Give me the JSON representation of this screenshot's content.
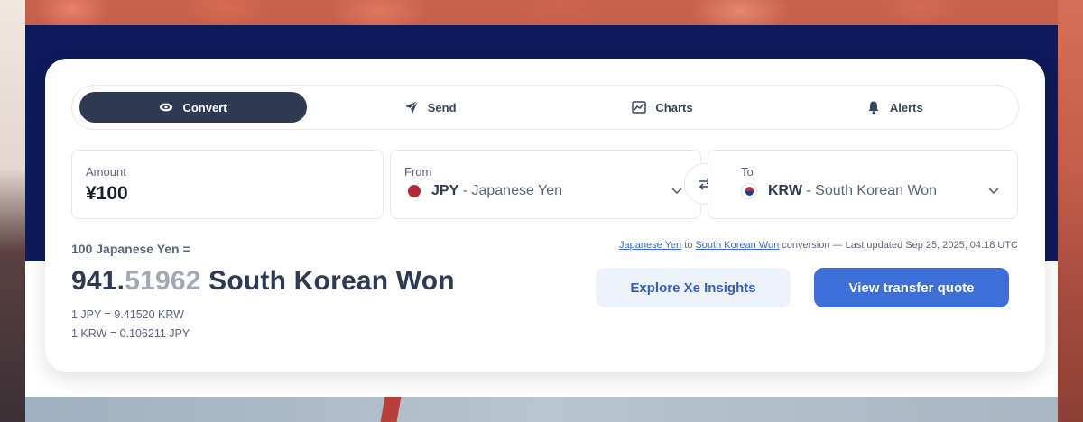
{
  "tabs": [
    {
      "label": "Convert",
      "icon": "money-icon",
      "active": true
    },
    {
      "label": "Send",
      "icon": "send-icon",
      "active": false
    },
    {
      "label": "Charts",
      "icon": "chart-icon",
      "active": false
    },
    {
      "label": "Alerts",
      "icon": "bell-icon",
      "active": false
    }
  ],
  "amount": {
    "label": "Amount",
    "value": "¥100"
  },
  "from": {
    "label": "From",
    "code": "JPY",
    "name": "- Japanese Yen"
  },
  "to": {
    "label": "To",
    "code": "KRW",
    "name": "- South Korean Won"
  },
  "result": {
    "line1": "100 Japanese Yen =",
    "int_part": "941.",
    "dec_part": "51962",
    "currency": " South Korean Won",
    "rate1": "1 JPY = 9.41520 KRW",
    "rate2": "1 KRW = 0.106211 JPY"
  },
  "update": {
    "link1": "Japanese Yen",
    "to_word": " to ",
    "link2": "South Korean Won",
    "suffix": " conversion — Last updated Sep 25, 2025, 04:18 UTC"
  },
  "buttons": {
    "insights": "Explore Xe Insights",
    "quote": "View transfer quote"
  },
  "colors": {
    "navy": "#0f1a5c",
    "accent": "#3e6fd8",
    "active_tab": "#2e3a52"
  }
}
